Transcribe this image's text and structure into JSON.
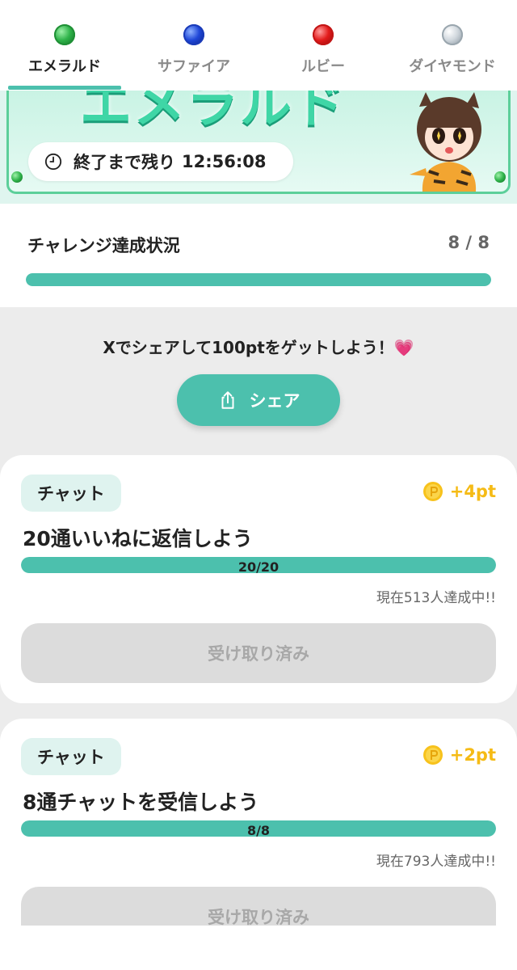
{
  "tabs": [
    {
      "label": "エメラルド",
      "icon": "emerald-icon",
      "active": true
    },
    {
      "label": "サファイア",
      "icon": "sapphire-icon",
      "active": false
    },
    {
      "label": "ルビー",
      "icon": "ruby-icon",
      "active": false
    },
    {
      "label": "ダイヤモンド",
      "icon": "diamond-icon",
      "active": false
    }
  ],
  "banner": {
    "title": "エメラルド",
    "timer_label": "終了まで残り",
    "timer_value": "12:56:08"
  },
  "status": {
    "title": "チャレンジ達成状況",
    "count": "8 / 8",
    "progress": 1.0
  },
  "share": {
    "text": "Xでシェアして100ptをゲットしよう！💗",
    "button_label": "シェア"
  },
  "tasks": [
    {
      "tag": "チャット",
      "reward": "+4pt",
      "title": "20通いいねに返信しよう",
      "progress_label": "20/20",
      "progress": 1.0,
      "achieved_text": "現在513人達成中!!",
      "button_label": "受け取り済み"
    },
    {
      "tag": "チャット",
      "reward": "+2pt",
      "title": "8通チャットを受信しよう",
      "progress_label": "8/8",
      "progress": 1.0,
      "achieved_text": "現在793人達成中!!",
      "button_label": "受け取り済み"
    }
  ],
  "colors": {
    "accent": "#4cc0ad",
    "reward": "#f5bb16",
    "disabled": "#dcdcdc"
  }
}
